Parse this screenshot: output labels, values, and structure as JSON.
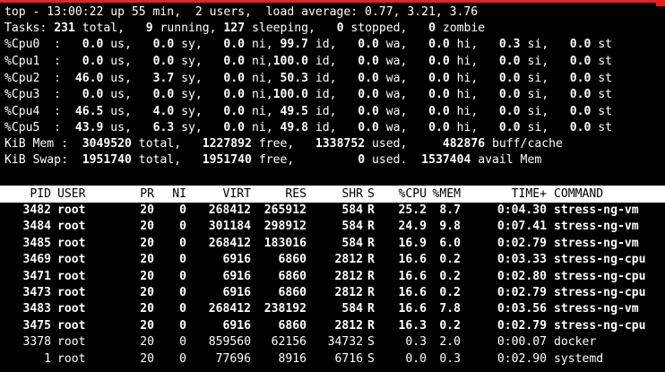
{
  "summary": {
    "line1": "top - 13:00:22 up 55 min,  2 users,  load average: 0.77, 3.21, 3.76",
    "tasks": [
      {
        "t": "Tasks: ",
        "b": false
      },
      {
        "t": "231",
        "b": true
      },
      {
        "t": " total,   ",
        "b": false
      },
      {
        "t": "9",
        "b": true
      },
      {
        "t": " running, ",
        "b": false
      },
      {
        "t": "127",
        "b": true
      },
      {
        "t": " sleeping,   ",
        "b": false
      },
      {
        "t": "0",
        "b": true
      },
      {
        "t": " stopped,   ",
        "b": false
      },
      {
        "t": "0",
        "b": true
      },
      {
        "t": " zombie",
        "b": false
      }
    ],
    "cpus": [
      {
        "label": "%Cpu0  : ",
        "us": "  0.0",
        "sy": "  0.0",
        "ni": "  0.0",
        "id": " 99.7",
        "wa": "  0.0",
        "hi": "  0.0",
        "si": "  0.3",
        "st": "  0.0"
      },
      {
        "label": "%Cpu1  : ",
        "us": "  0.0",
        "sy": "  0.0",
        "ni": "  0.0",
        "id": "100.0",
        "wa": "  0.0",
        "hi": "  0.0",
        "si": "  0.0",
        "st": "  0.0"
      },
      {
        "label": "%Cpu2  : ",
        "us": " 46.0",
        "sy": "  3.7",
        "ni": "  0.0",
        "id": " 50.3",
        "wa": "  0.0",
        "hi": "  0.0",
        "si": "  0.0",
        "st": "  0.0"
      },
      {
        "label": "%Cpu3  : ",
        "us": "  0.0",
        "sy": "  0.0",
        "ni": "  0.0",
        "id": "100.0",
        "wa": "  0.0",
        "hi": "  0.0",
        "si": "  0.0",
        "st": "  0.0"
      },
      {
        "label": "%Cpu4  : ",
        "us": " 46.5",
        "sy": "  4.0",
        "ni": "  0.0",
        "id": " 49.5",
        "wa": "  0.0",
        "hi": "  0.0",
        "si": "  0.0",
        "st": "  0.0"
      },
      {
        "label": "%Cpu5  : ",
        "us": " 43.9",
        "sy": "  6.3",
        "ni": "  0.0",
        "id": " 49.8",
        "wa": "  0.0",
        "hi": "  0.0",
        "si": "  0.0",
        "st": "  0.0"
      }
    ],
    "mem": [
      {
        "t": "KiB Mem : ",
        "b": false
      },
      {
        "t": " 3049520",
        "b": true
      },
      {
        "t": " total,  ",
        "b": false
      },
      {
        "t": " 1227892",
        "b": true
      },
      {
        "t": " free,  ",
        "b": false
      },
      {
        "t": " 1338752",
        "b": true
      },
      {
        "t": " used,   ",
        "b": false
      },
      {
        "t": "  482876",
        "b": true
      },
      {
        "t": " buff/cache",
        "b": false
      }
    ],
    "swap": [
      {
        "t": "KiB Swap: ",
        "b": false
      },
      {
        "t": " 1951740",
        "b": true
      },
      {
        "t": " total,  ",
        "b": false
      },
      {
        "t": " 1951740",
        "b": true
      },
      {
        "t": " free,  ",
        "b": false
      },
      {
        "t": "       0",
        "b": true
      },
      {
        "t": " used. ",
        "b": false
      },
      {
        "t": " 1537404",
        "b": true
      },
      {
        "t": " avail Mem",
        "b": false
      }
    ]
  },
  "table": {
    "headers": [
      "PID",
      "USER",
      "PR",
      "NI",
      "VIRT",
      "RES",
      "SHR",
      "S",
      "%CPU",
      "%MEM",
      "TIME+",
      "COMMAND"
    ],
    "rows": [
      {
        "bold": true,
        "cells": [
          "3482",
          "root",
          "20",
          "0",
          "268412",
          "265912",
          "584",
          "R",
          "25.2",
          "8.7",
          "0:04.30",
          "stress-ng-vm"
        ]
      },
      {
        "bold": true,
        "cells": [
          "3484",
          "root",
          "20",
          "0",
          "301184",
          "298912",
          "584",
          "R",
          "24.9",
          "9.8",
          "0:07.41",
          "stress-ng-vm"
        ]
      },
      {
        "bold": true,
        "cells": [
          "3485",
          "root",
          "20",
          "0",
          "268412",
          "183016",
          "584",
          "R",
          "16.9",
          "6.0",
          "0:02.79",
          "stress-ng-vm"
        ]
      },
      {
        "bold": true,
        "cells": [
          "3469",
          "root",
          "20",
          "0",
          "6916",
          "6860",
          "2812",
          "R",
          "16.6",
          "0.2",
          "0:03.33",
          "stress-ng-cpu"
        ]
      },
      {
        "bold": true,
        "cells": [
          "3471",
          "root",
          "20",
          "0",
          "6916",
          "6860",
          "2812",
          "R",
          "16.6",
          "0.2",
          "0:02.80",
          "stress-ng-cpu"
        ]
      },
      {
        "bold": true,
        "cells": [
          "3473",
          "root",
          "20",
          "0",
          "6916",
          "6860",
          "2812",
          "R",
          "16.6",
          "0.2",
          "0:02.79",
          "stress-ng-cpu"
        ]
      },
      {
        "bold": true,
        "cells": [
          "3483",
          "root",
          "20",
          "0",
          "268412",
          "238192",
          "584",
          "R",
          "16.6",
          "7.8",
          "0:03.56",
          "stress-ng-vm"
        ]
      },
      {
        "bold": true,
        "cells": [
          "3475",
          "root",
          "20",
          "0",
          "6916",
          "6860",
          "2812",
          "R",
          "16.3",
          "0.2",
          "0:02.79",
          "stress-ng-cpu"
        ]
      },
      {
        "bold": false,
        "cells": [
          "3378",
          "root",
          "20",
          "0",
          "859560",
          "62156",
          "34732",
          "S",
          "0.3",
          "2.0",
          "0:00.07",
          "docker"
        ]
      },
      {
        "bold": false,
        "cells": [
          "1",
          "root",
          "20",
          "0",
          "77696",
          "8916",
          "6716",
          "S",
          "0.0",
          "0.3",
          "0:02.90",
          "systemd"
        ]
      }
    ]
  }
}
